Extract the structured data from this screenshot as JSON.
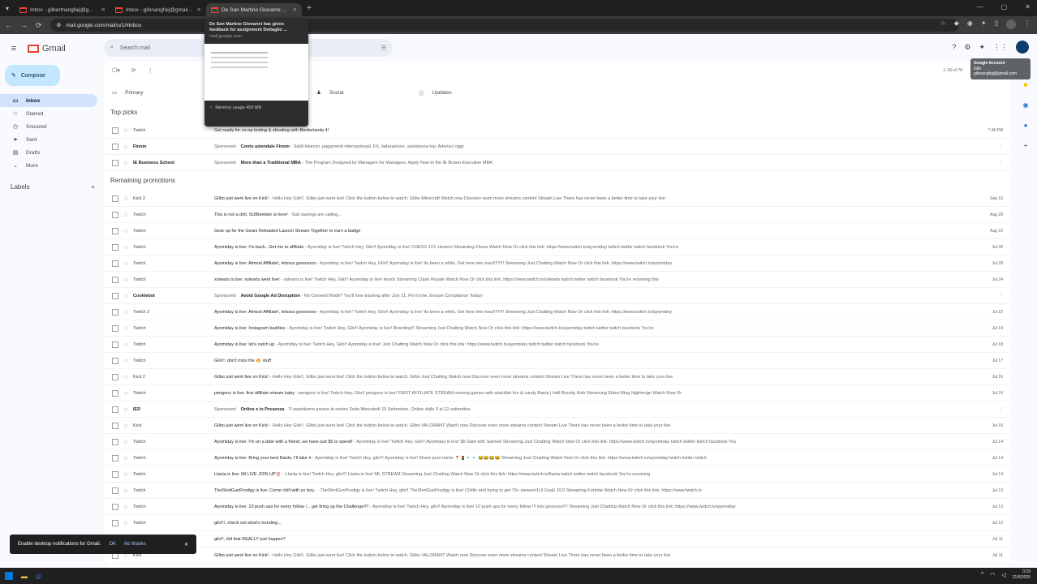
{
  "browser": {
    "tabs": [
      {
        "title": "Inbox - gilbertnangfaij@gmail.com",
        "active": false
      },
      {
        "title": "Inbox - gilsnangfaij@gmail.com",
        "active": false
      },
      {
        "title": "De San Martino Giovanni has given feedback",
        "active": true
      }
    ],
    "url": "mail.google.com/mail/u/1/#inbox",
    "new_tab": "+"
  },
  "tab_preview": {
    "title": "De San Martino Giovanni has given feedback for assignment Dettaglio ...",
    "url": "mail.google.com",
    "memory": "Memory usage 459 MB"
  },
  "gmail": {
    "logo_text": "Gmail",
    "search_placeholder": "Search mail",
    "compose_label": "Compose",
    "nav": [
      {
        "label": "Inbox",
        "icon": "inbox-icon",
        "active": true
      },
      {
        "label": "Starred",
        "icon": "star-icon",
        "active": false
      },
      {
        "label": "Snoozed",
        "icon": "clock-icon",
        "active": false
      },
      {
        "label": "Sent",
        "icon": "send-icon",
        "active": false
      },
      {
        "label": "Drafts",
        "icon": "draft-icon",
        "active": false
      },
      {
        "label": "More",
        "icon": "chevron-down-icon",
        "active": false
      }
    ],
    "labels_heading": "Labels",
    "pager": "1–50 of 78",
    "tabs": [
      "Primary",
      "Promotions",
      "Social",
      "Updates"
    ],
    "tooltip": {
      "line1": "Google Account",
      "line2": "Gilo",
      "line3": "gilsnangfaij@gmail.com"
    },
    "section_top": "Top picks",
    "section_remaining": "Remaining promotions",
    "top_picks": [
      {
        "sender": "Twitch",
        "subject": "Get ready for co-op looting & shooting with Borderlands 4!",
        "snippet": "",
        "date": "7:48 PM",
        "ad": false
      },
      {
        "sender": "Finom",
        "subject": "Conto aziendale Finom",
        "snippet": "Sponsored",
        "body": "Saldi bilancio, pagamenti internazionali, FX, fatturazione, assistenza top. Aderisci oggi",
        "date": "",
        "ad": true
      },
      {
        "sender": "IE Business School",
        "subject": "More than a Traditional MBA",
        "snippet": "Sponsored",
        "body": "The Program Designed by Managers for Managers. Apply Now to the IE Brown Executive MBA",
        "date": "",
        "ad": true
      }
    ],
    "emails": [
      {
        "sender": "Kick 2",
        "subject": "Gilbo just went live on Kick!",
        "snippet": " - Hello Hey Gilo!!, Gilbo just went live! Click the button below to watch. Gilbo Minecraft Watch now Discover even more streams content Stream Live There has never been a better time to take your live",
        "date": "Sep 10",
        "ad": false
      },
      {
        "sender": "Twitch",
        "subject": "This is not a drill, SUBtember is here!",
        "snippet": " - Sub savings are calling...",
        "date": "Aug 29",
        "ad": false
      },
      {
        "sender": "Twitch",
        "subject": "Gear up for the Gears Reloaded Launch Stream Together to earn a badge",
        "snippet": "",
        "date": "Aug 22",
        "ad": false
      },
      {
        "sender": "Twitch",
        "subject": "Ayomiday is live: I'm back.. Get me to affiliate",
        "snippet": " - Ayomiday is live! Twitch Hey, Gilo!! Ayomiday is live! CHESS 1V1 viewers Streaming Chess Watch Now Or click this link: https://www.twitch.tv/ayomiday twitch twitter twitch facebook You're",
        "date": "Jul 30",
        "ad": false
      },
      {
        "sender": "Twitch",
        "subject": "Ayomiday is live: Almost Affiliate!, letssss gooooooo",
        "snippet": " - Ayomiday is live! Twitch Hey, Gilo!! Ayomiday is live! Its been a while, Get here lets react!!!!!!!! Streaming Just Chatting Watch Now Or click this link: https://www.twitch.tv/ayomiday",
        "date": "Jul 28",
        "ad": false
      },
      {
        "sender": "Twitch",
        "subject": "xslearts is live: xslearts went live!",
        "snippet": " - xslearts is live! Twitch Hey, Gilo!! Ayomiday is live! knock Streaming Clash Royale Watch Now Or click this link: https://www.twitch.tv/xslearts twitch twitter twitch facebook You're receiving this",
        "date": "Jul 24",
        "ad": false
      },
      {
        "sender": "Cookiebot",
        "subject": "Avoid Google Ad Disruption",
        "snippet": "Sponsored",
        "body": "No Consent Mode? You'll lose tracking after July 21. Fix it now. Ensure Compliance Today!",
        "date": "",
        "ad": true
      },
      {
        "sender": "Twitch 2",
        "subject": "Ayomiday is live: Almost Affiliate!, letssss gooooooo",
        "snippet": " - Ayomiday is live! Twitch Hey, Gilo!! Ayomiday is live! Its been a while, Get here lets react!!!!!!!! Streaming Just Chatting Watch Now Or click this link: https://www.twitch.tv/ayomiday",
        "date": "Jul 22",
        "ad": false
      },
      {
        "sender": "Twitch",
        "subject": "Ayomiday is live: Instagram baddies",
        "snippet": " - Ayomiday is live! Twitch Hey, Gilo!! Ayomiday is live! Reacting!!! Streaming Just Chatting Watch Now Or click this link: https://www.twitch.tv/ayomiday twitch twitter twitch facebook You're",
        "date": "Jul 19",
        "ad": false
      },
      {
        "sender": "Twitch",
        "subject": "Ayomiday is live: let's catch up",
        "snippet": " - Ayomiday is live! Twitch Hey, Gilo!! Ayomiday is live! Just Chatting Watch Now Or click this link: https://www.twitch.tv/ayomiday twitch twitter twitch facebook You're",
        "date": "Jul 18",
        "ad": false
      },
      {
        "sender": "Twitch",
        "subject": "Gilo!!, don't miss the 🔥 stuff",
        "snippet": "",
        "date": "Jul 17",
        "ad": false
      },
      {
        "sender": "Kick 2",
        "subject": "Gilbo just went live on Kick!",
        "snippet": " - Hello Hey Gilo!!, Gilbo just went live! Click the button below to watch. Gilbo Just Chatting Watch now Discover even more streams content Stream Live There has never been a better time to take your live",
        "date": "Jul 16",
        "ad": false
      },
      {
        "sender": "Twitch",
        "subject": "pengenz is live: first affiliate stream baby",
        "snippet": " - pengenz is live! Twitch Hey, Gilo!! pengenz is live! FIRST AFFILIATE STREAM running games with abdullah fun & candy Bants | Hell Bounty Kids Streaming Elden Ring Nightreign Watch Now Or",
        "date": "Jul 16",
        "ad": false
      },
      {
        "sender": "IED",
        "subject": "Online e in Presenza",
        "snippet": "Sponsored",
        "body": "Ti aspettiamo presso la nostra Sede Mercoledì 10 Settembre. Online dalle 9 al 12 settembre.",
        "date": "",
        "ad": true
      },
      {
        "sender": "Kick",
        "subject": "Gilbo just went live on Kick!",
        "snippet": " - Hello Hey Gilo!!, Gilbo just went live! Click the button below to watch. Gilbo VALORANT Watch now Discover even more streams content Stream Live There has never been a better time to take your live",
        "date": "Jul 16",
        "ad": false
      },
      {
        "sender": "Twitch",
        "subject": "Ayomiday is live: I'm on a date with a friend, we have just $5 to spend!",
        "snippet": " - Ayomiday is live! Twitch Hey, Gilo!! Ayomiday is live! $5 Date with Samuel Streaming Just Chatting Watch Now Or click this link: https://www.twitch.tv/ayomiday twitch twitter twitch facebook You",
        "date": "Jul 14",
        "ad": false
      },
      {
        "sender": "Twitch",
        "subject": "Ayomiday is live: Bring your best Bants, I'll take it",
        "snippet": " - Ayomiday is live! Twitch Hey, gilo!!! Ayomiday is live! Share pure bants 📍🚦🔹🔹 😂😂😂😂 Streaming Just Chatting Watch Now Or click this link: https://www.twitch.tv/ayomiday twitch twitter twitch",
        "date": "Jul 14",
        "ad": false
      },
      {
        "sender": "Twitch",
        "subject": "Llania is live: IM LIVE JOIN UP‼️",
        "snippet": " - Llania is live! Twitch Hey, gilo!!! Llania is live! ML STREAM Streaming Just Chatting Watch Now Or click this link: https://www.twitch.tv/llania twitch twitter twitch facebook You're receiving",
        "date": "Jul 14",
        "ad": false
      },
      {
        "sender": "Twitch",
        "subject": "TheShotGunProdigy is live: Come chill with yo boy..",
        "snippet": " - TheShotGunProdigy is live! Twitch Hey, gilo!! TheShotGunProdigy is live! Chillin and trying to get 70+ viewers!(Lil Goal) 2/10 Streaming Fortnite Watch Now Or click this link: https://www.twitch.tv",
        "date": "Jul 13",
        "ad": false
      },
      {
        "sender": "Twitch",
        "subject": "Ayomiday is live: 10 push ups for every follow !... get firing up the Challenge!!!!",
        "snippet": " - Ayomiday is live! Twitch Hey, gilo!! Ayomiday is live! 10 push ups for every follow !!! lets goooooo!!!! Streaming Just Chatting Watch Now Or click this link: https://www.twitch.tv/ayomiday",
        "date": "Jul 13",
        "ad": false
      },
      {
        "sender": "Twitch",
        "subject": "gilo!!!, check out what's trending...",
        "snippet": "",
        "date": "Jul 12",
        "ad": false
      },
      {
        "sender": "Twitch",
        "subject": "gilo!!, did that REALLY just happen?",
        "snippet": "",
        "date": "Jul 11",
        "ad": false
      },
      {
        "sender": "Kick",
        "subject": "Gilbo just went live on Kick!",
        "snippet": " - Hello Hey Gilo!!, Gilbo just went live! Click the button below to watch. Gilbo VALORANT Watch now Discover even more streams content Stream Live There has never been a better time to take your live",
        "date": "Jul 11",
        "ad": false
      }
    ],
    "toast": {
      "text": "Enable desktop notifications for Gmail.",
      "ok": "OK",
      "no": "No thanks",
      "close": "✕"
    }
  },
  "taskbar": {
    "time": "0:29",
    "date": "21/6/2025"
  }
}
